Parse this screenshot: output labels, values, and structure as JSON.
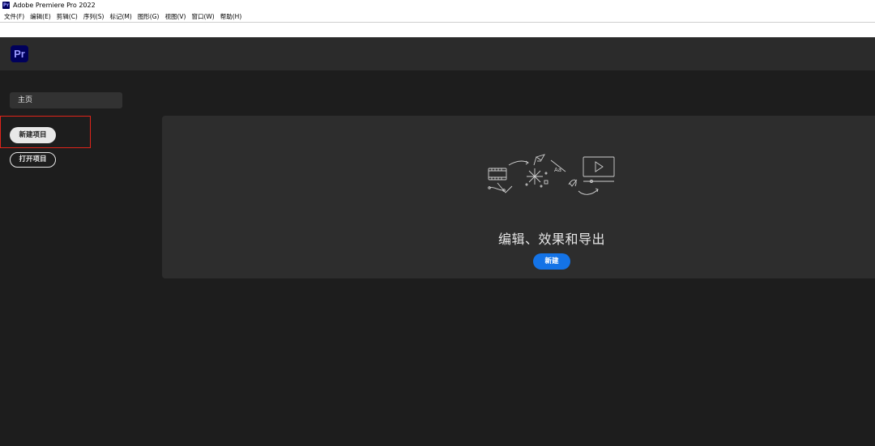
{
  "window": {
    "icon_text": "Pr",
    "title": "Adobe Premiere Pro 2022"
  },
  "menu": {
    "items": [
      "文件(F)",
      "编辑(E)",
      "剪辑(C)",
      "序列(S)",
      "标记(M)",
      "图形(G)",
      "视图(V)",
      "窗口(W)",
      "帮助(H)"
    ]
  },
  "header": {
    "logo_text": "Pr"
  },
  "sidebar": {
    "home_label": "主页",
    "new_project_label": "新建项目",
    "open_project_label": "打开项目"
  },
  "hero": {
    "title": "编辑、效果和导出",
    "create_label": "新建"
  },
  "colors": {
    "accent": "#1473e6",
    "highlight_border": "#e0241a",
    "pr_brand": "#00005b",
    "pr_brand_text": "#9999ff"
  },
  "icons": [
    "film-strip-icon",
    "pen-icon",
    "sparkle-icon",
    "text-aa-icon",
    "video-play-icon"
  ]
}
